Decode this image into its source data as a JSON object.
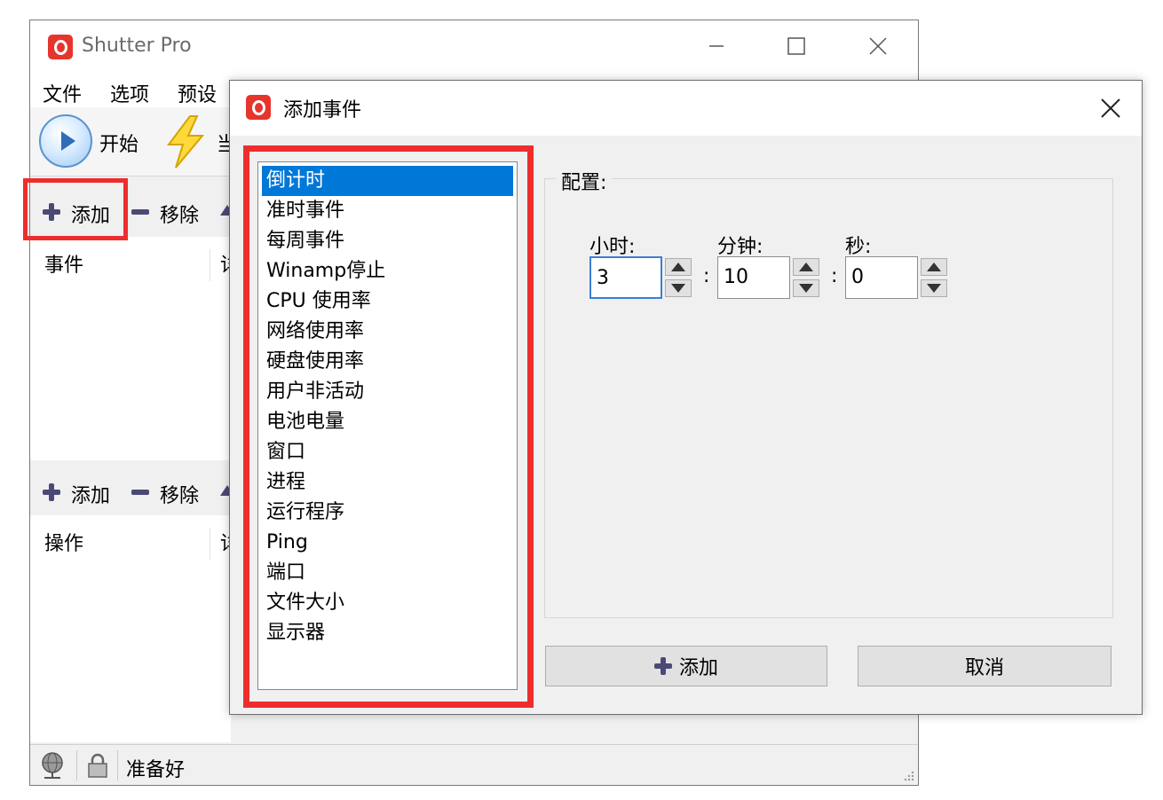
{
  "main_window": {
    "title": "Shutter Pro",
    "menu": [
      "文件",
      "选项",
      "预设"
    ],
    "toolbar": {
      "start_label": "开始",
      "cut_label": "当"
    },
    "events_toolbar": {
      "add_label": "添加",
      "remove_label": "移除"
    },
    "events_header": {
      "col1": "事件",
      "col2": "详"
    },
    "actions_toolbar": {
      "add_label": "添加",
      "remove_label": "移除"
    },
    "actions_header": {
      "col1": "操作",
      "col2": "详"
    },
    "status": "准备好"
  },
  "dialog": {
    "title": "添加事件",
    "events": [
      "倒计时",
      "准时事件",
      "每周事件",
      "Winamp停止",
      "CPU 使用率",
      "网络使用率",
      "硬盘使用率",
      "用户非活动",
      "电池电量",
      "窗口",
      "进程",
      "运行程序",
      "Ping",
      "端口",
      "文件大小",
      "显示器"
    ],
    "selected_event": "倒计时",
    "config": {
      "label": "配置:",
      "hours_label": "小时:",
      "hours_value": "3",
      "minutes_label": "分钟:",
      "minutes_value": "10",
      "seconds_label": "秒:",
      "seconds_value": "0",
      "separator": ":"
    },
    "add_button": "添加",
    "cancel_button": "取消"
  },
  "colors": {
    "highlight": "#ee2d2d",
    "selection": "#0078d7",
    "logo": "#e5352c"
  }
}
